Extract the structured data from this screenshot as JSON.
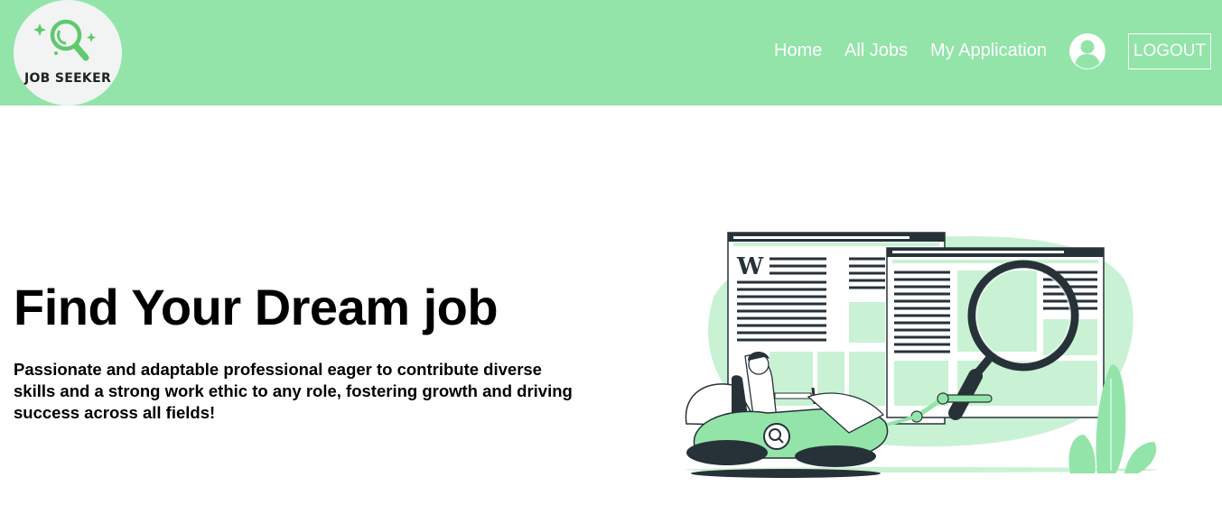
{
  "brand": {
    "logo_text": "JOB SEEKER",
    "accent_color": "#93e4a9"
  },
  "nav": {
    "home": "Home",
    "all_jobs": "All Jobs",
    "my_application": "My Application",
    "profile_icon": "user-circle-icon",
    "logout": "LOGOUT"
  },
  "hero": {
    "title": "Find Your Dream job",
    "description": "Passionate and adaptable professional eager to contribute diverse skills and a strong work ethic to any role, fostering growth and driving success across all fields!",
    "illustration_letter": "W"
  }
}
